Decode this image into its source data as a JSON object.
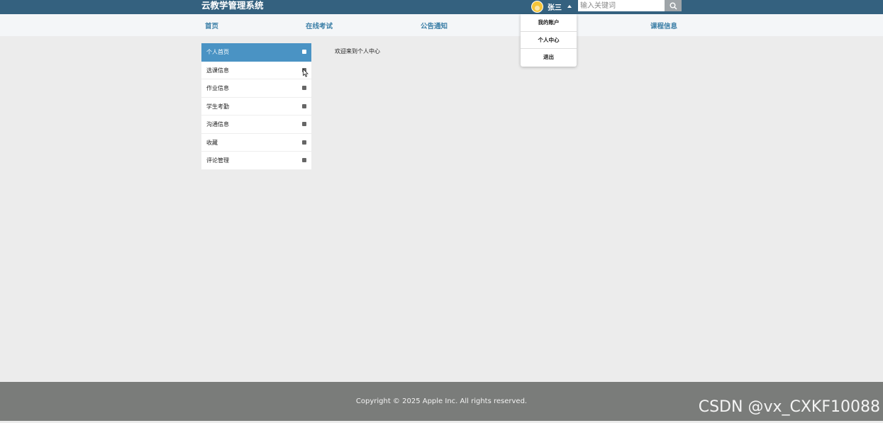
{
  "header": {
    "brand": "云教学管理系统",
    "username": "张三",
    "search_placeholder": "输入关键词"
  },
  "nav": {
    "items": [
      "首页",
      "在线考试",
      "公告通知",
      "课程信息"
    ]
  },
  "user_menu": {
    "items": [
      "我的账户",
      "个人中心",
      "退出"
    ]
  },
  "sidebar": {
    "items": [
      {
        "label": "个人首页",
        "active": true
      },
      {
        "label": "选课信息",
        "active": false
      },
      {
        "label": "作业信息",
        "active": false
      },
      {
        "label": "学生考勤",
        "active": false
      },
      {
        "label": "沟通信息",
        "active": false
      },
      {
        "label": "收藏",
        "active": false
      },
      {
        "label": "评论管理",
        "active": false
      }
    ]
  },
  "main": {
    "welcome": "欢迎来到个人中心"
  },
  "footer": {
    "copyright": "Copyright © 2025 Apple Inc. All rights reserved."
  },
  "watermark": "CSDN @vx_CXKF10088",
  "colors": {
    "topbar": "#34617f",
    "accent": "#4a93c4",
    "nav_text": "#3a7ea6",
    "footer": "#7a7c7a"
  }
}
